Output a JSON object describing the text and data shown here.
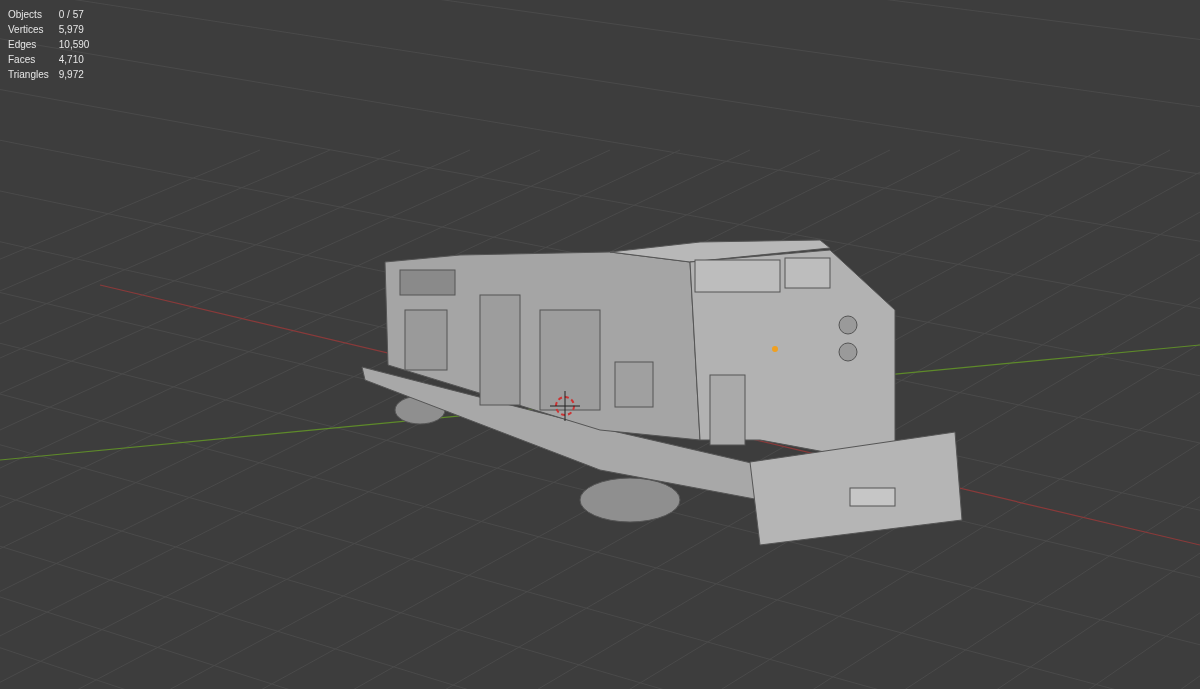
{
  "viewport": {
    "stats": [
      {
        "label": "Objects",
        "value": "0 / 57"
      },
      {
        "label": "Vertices",
        "value": "5,979"
      },
      {
        "label": "Edges",
        "value": "10,590"
      },
      {
        "label": "Faces",
        "value": "4,710"
      },
      {
        "label": "Triangles",
        "value": "9,972"
      }
    ]
  }
}
